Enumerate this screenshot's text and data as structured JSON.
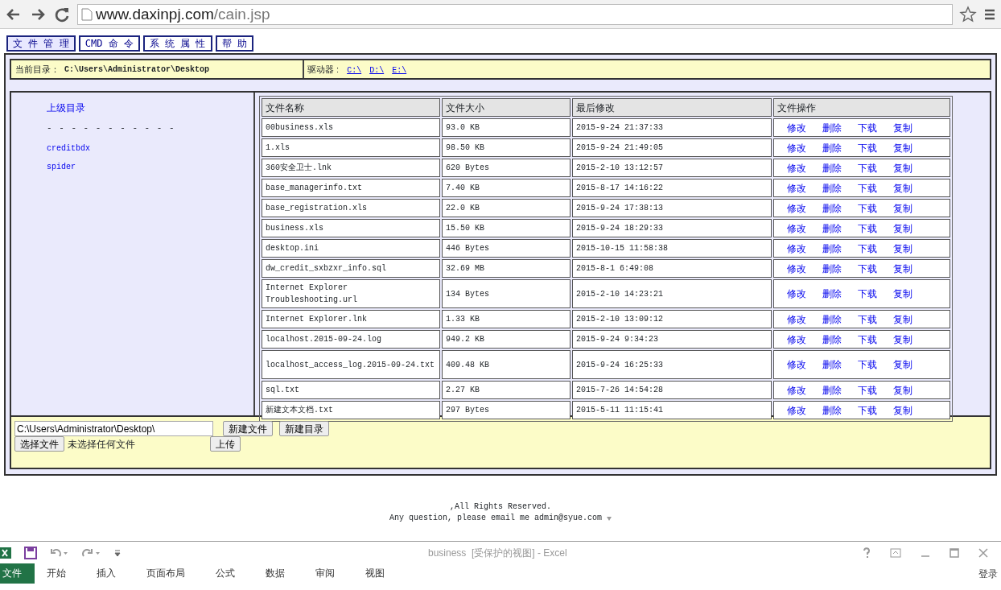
{
  "browser": {
    "url_host": "www.daxinpj.com",
    "url_path": "/cain.jsp"
  },
  "menu": [
    {
      "label": "文 件 管 理",
      "selected": true
    },
    {
      "label": "CMD 命 令",
      "selected": false
    },
    {
      "label": "系 统 属 性",
      "selected": false
    },
    {
      "label": "帮 助",
      "selected": false
    }
  ],
  "current_dir": {
    "label": "当前目录：",
    "path": "C:\\Users\\Administrator\\Desktop"
  },
  "drives": {
    "label": "驱动器 :",
    "items": [
      "C:\\",
      "D:\\",
      "E:\\"
    ]
  },
  "sidebar": {
    "parent_link": "上级目录",
    "separator": "- - - - - - - - - - -",
    "folders": [
      "creditbdx",
      "spider"
    ]
  },
  "table": {
    "columns": [
      "文件名称",
      "文件大小",
      "最后修改",
      "文件操作"
    ],
    "rows": [
      {
        "name": "00business.xls",
        "size": "93.0 KB",
        "modified": "2015-9-24 21:37:33",
        "actions": [
          "修改",
          "删除",
          "下载",
          "复制"
        ]
      },
      {
        "name": "1.xls",
        "size": "98.50 KB",
        "modified": "2015-9-24 21:49:05",
        "actions": [
          "修改",
          "删除",
          "下载",
          "复制"
        ]
      },
      {
        "name": "360安全卫士.lnk",
        "size": "620 Bytes",
        "modified": "2015-2-10 13:12:57",
        "actions": [
          "修改",
          "删除",
          "下载",
          "复制"
        ]
      },
      {
        "name": "base_managerinfo.txt",
        "size": "7.40 KB",
        "modified": "2015-8-17 14:16:22",
        "actions": [
          "修改",
          "删除",
          "下载",
          "复制"
        ]
      },
      {
        "name": "base_registration.xls",
        "size": "22.0 KB",
        "modified": "2015-9-24 17:38:13",
        "actions": [
          "修改",
          "删除",
          "下载",
          "复制"
        ]
      },
      {
        "name": "business.xls",
        "size": "15.50 KB",
        "modified": "2015-9-24 18:29:33",
        "actions": [
          "修改",
          "删除",
          "下载",
          "复制"
        ]
      },
      {
        "name": "desktop.ini",
        "size": "446 Bytes",
        "modified": "2015-10-15 11:58:38",
        "actions": [
          "修改",
          "删除",
          "下载",
          "复制"
        ]
      },
      {
        "name": "dw_credit_sxbzxr_info.sql",
        "size": "32.69 MB",
        "modified": "2015-8-1 6:49:08",
        "actions": [
          "修改",
          "删除",
          "下载",
          "复制"
        ]
      },
      {
        "name": "Internet Explorer Troubleshooting.url",
        "size": "134 Bytes",
        "modified": "2015-2-10 14:23:21",
        "actions": [
          "修改",
          "删除",
          "下载",
          "复制"
        ]
      },
      {
        "name": "Internet Explorer.lnk",
        "size": "1.33 KB",
        "modified": "2015-2-10 13:09:12",
        "actions": [
          "修改",
          "删除",
          "下载",
          "复制"
        ]
      },
      {
        "name": "localhost.2015-09-24.log",
        "size": "949.2 KB",
        "modified": "2015-9-24 9:34:23",
        "actions": [
          "修改",
          "删除",
          "下载",
          "复制"
        ]
      },
      {
        "name": "localhost_access_log.2015-09-24.txt",
        "size": "409.48 KB",
        "modified": "2015-9-24 16:25:33",
        "actions": [
          "修改",
          "删除",
          "下载",
          "复制"
        ]
      },
      {
        "name": "sql.txt",
        "size": "2.27 KB",
        "modified": "2015-7-26 14:54:28",
        "actions": [
          "修改",
          "删除",
          "下载",
          "复制"
        ]
      },
      {
        "name": "新建文本文档.txt",
        "size": "297 Bytes",
        "modified": "2015-5-11 11:15:41",
        "actions": [
          "修改",
          "删除",
          "下载",
          "复制"
        ]
      }
    ]
  },
  "form": {
    "path_value": "C:\\Users\\Administrator\\Desktop\\",
    "new_file": "新建文件",
    "new_dir": "新建目录",
    "choose_file": "选择文件",
    "no_file": "未选择任何文件",
    "upload": "上传"
  },
  "footer": [
    ",All Rights Reserved.",
    "Any question, please email me admin@syue.com"
  ],
  "excel": {
    "title": "business  [受保护的视图] - Excel",
    "tabs": [
      {
        "label": "文件",
        "selected": true
      },
      {
        "label": "开始",
        "selected": false
      },
      {
        "label": "插入",
        "selected": false
      },
      {
        "label": "页面布局",
        "selected": false
      },
      {
        "label": "公式",
        "selected": false
      },
      {
        "label": "数据",
        "selected": false
      },
      {
        "label": "审阅",
        "selected": false
      },
      {
        "label": "视图",
        "selected": false
      }
    ],
    "signin": "登录"
  }
}
